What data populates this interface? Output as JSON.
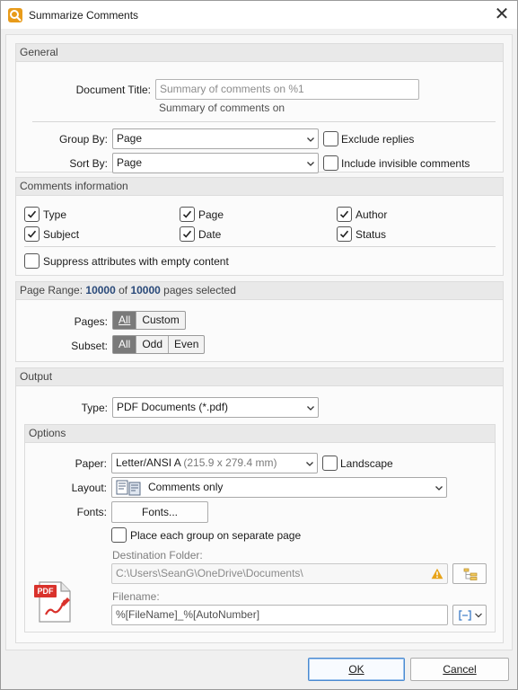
{
  "window": {
    "title": "Summarize Comments",
    "close_glyph": "✕"
  },
  "general": {
    "header": "General",
    "doc_title_label": "Document Title:",
    "doc_title_placeholder": "Summary of comments on %1",
    "doc_title_preview": "Summary of comments on",
    "group_by_label": "Group By:",
    "group_by_value": "Page",
    "exclude_replies_label": "Exclude replies",
    "exclude_replies_checked": false,
    "sort_by_label": "Sort By:",
    "sort_by_value": "Page",
    "include_invisible_label": "Include invisible comments",
    "include_invisible_checked": false
  },
  "comments_info": {
    "header": "Comments information",
    "items": [
      {
        "label": "Type",
        "checked": true
      },
      {
        "label": "Page",
        "checked": true
      },
      {
        "label": "Author",
        "checked": true
      },
      {
        "label": "Subject",
        "checked": true
      },
      {
        "label": "Date",
        "checked": true
      },
      {
        "label": "Status",
        "checked": true
      }
    ],
    "suppress_label": "Suppress attributes with empty content",
    "suppress_checked": false
  },
  "page_range": {
    "header_prefix": "Page Range: ",
    "selected": "10000",
    "of": " of ",
    "total": "10000",
    "suffix": " pages selected",
    "pages_label": "Pages:",
    "pages_options": [
      "All",
      "Custom"
    ],
    "pages_selected": "All",
    "subset_label": "Subset:",
    "subset_options": [
      "All",
      "Odd",
      "Even"
    ],
    "subset_selected": "All"
  },
  "output": {
    "header": "Output",
    "type_label": "Type:",
    "type_value": "PDF Documents (*.pdf)",
    "options": {
      "header": "Options",
      "paper_label": "Paper:",
      "paper_value": "Letter/ANSI A",
      "paper_dims": "(215.9 x 279.4 mm)",
      "landscape_label": "Landscape",
      "landscape_checked": false,
      "layout_label": "Layout:",
      "layout_value": "Comments only",
      "fonts_label": "Fonts:",
      "fonts_button": "Fonts...",
      "separate_page_label": "Place each group on separate page",
      "separate_page_checked": false,
      "dest_folder_label": "Destination Folder:",
      "dest_folder_value": "C:\\Users\\SeanG\\OneDrive\\Documents\\",
      "filename_label": "Filename:",
      "filename_value": "%[FileName]_%[AutoNumber]",
      "pdf_badge": "PDF"
    }
  },
  "buttons": {
    "ok": "OK",
    "cancel": "Cancel"
  },
  "colors": {
    "accent": "#4a8ad0",
    "pdf_red": "#d9322c",
    "segment_on": "#7a7a7a",
    "warning": "#e8a317"
  }
}
